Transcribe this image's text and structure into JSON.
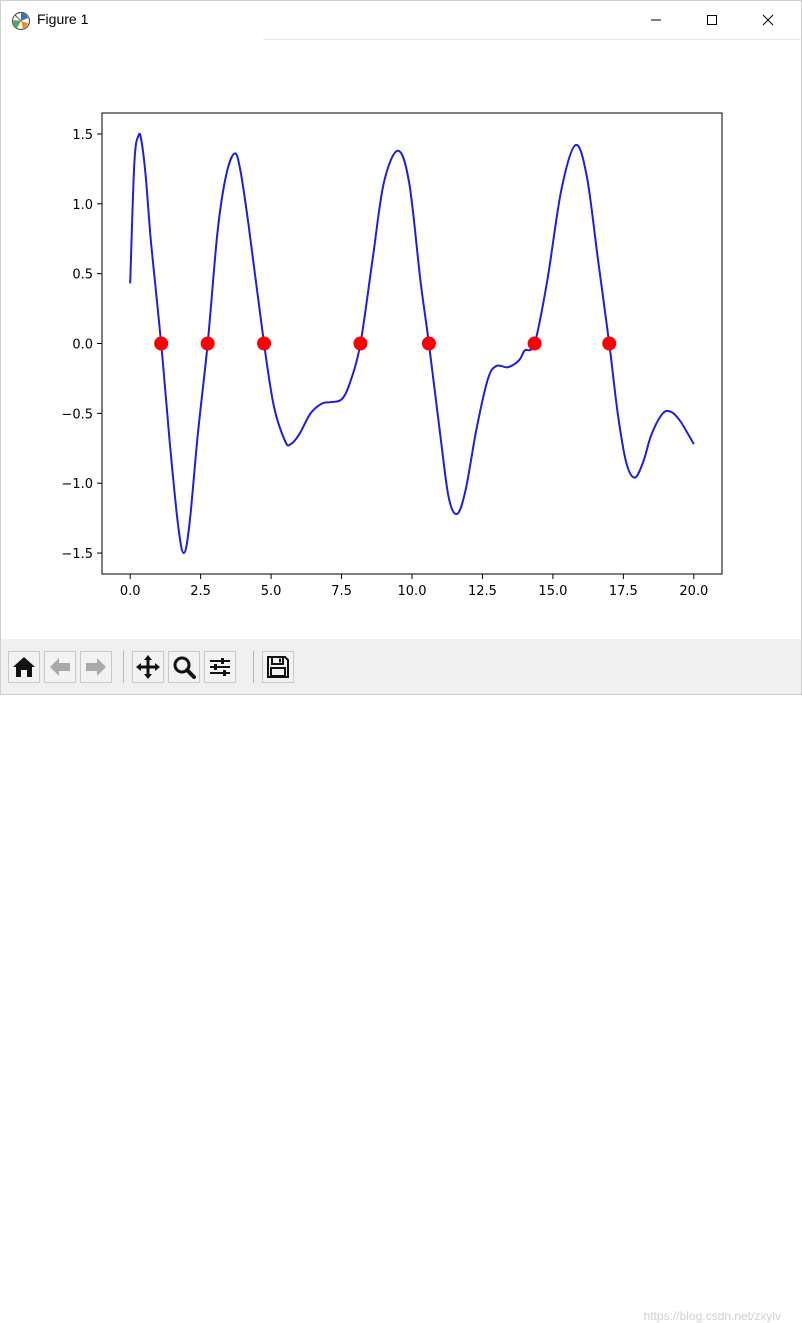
{
  "window": {
    "title": "Figure 1",
    "icon": "matplotlib-logo-icon",
    "controls": {
      "minimize": "minimize-icon",
      "maximize": "maximize-icon",
      "close": "close-icon"
    }
  },
  "toolbar": {
    "buttons": [
      {
        "name": "home",
        "icon": "home-icon"
      },
      {
        "name": "back",
        "icon": "arrow-left-icon"
      },
      {
        "name": "forward",
        "icon": "arrow-right-icon"
      },
      {
        "name": "pan",
        "icon": "move-icon"
      },
      {
        "name": "zoom",
        "icon": "magnifier-icon"
      },
      {
        "name": "configure-subplots",
        "icon": "sliders-icon"
      },
      {
        "name": "save",
        "icon": "floppy-disk-icon"
      }
    ]
  },
  "watermark": "https://blog.csdn.net/zxylv",
  "chart_data": {
    "type": "line",
    "title": "",
    "xlabel": "",
    "ylabel": "",
    "xlim": [
      -1,
      21
    ],
    "ylim": [
      -1.65,
      1.65
    ],
    "xticks": [
      0,
      2.5,
      5,
      7.5,
      10,
      12.5,
      15,
      17.5,
      20
    ],
    "xtick_labels": [
      "0.0",
      "2.5",
      "5.0",
      "7.5",
      "10.0",
      "12.5",
      "15.0",
      "17.5",
      "20.0"
    ],
    "yticks": [
      -1.5,
      -1,
      -0.5,
      0,
      0.5,
      1,
      1.5
    ],
    "ytick_labels": [
      "−1.5",
      "−1.0",
      "−0.5",
      "0.0",
      "0.5",
      "1.0",
      "1.5"
    ],
    "grid": false,
    "colors": {
      "curve": "#1f1fd8",
      "roots": "#ff0000"
    },
    "series": [
      {
        "x": [
          0,
          0.15,
          0.3,
          0.4,
          0.55,
          0.75,
          1.1,
          1.4,
          1.7,
          1.9,
          2.1,
          2.4,
          2.75,
          3.1,
          3.4,
          3.7,
          3.9,
          4.2,
          4.75,
          5.1,
          5.5,
          5.7,
          6.0,
          6.4,
          6.8,
          7.1,
          7.5,
          7.8,
          8.17,
          8.6,
          9.0,
          9.5,
          9.9,
          10.3,
          10.6,
          11.0,
          11.3,
          11.6,
          11.9,
          12.3,
          12.7,
          13.0,
          13.4,
          13.8,
          14.0,
          14.35,
          14.8,
          15.3,
          15.8,
          16.2,
          16.6,
          17.0,
          17.3,
          17.6,
          17.9,
          18.2,
          18.5,
          18.9,
          19.2,
          19.5,
          19.8,
          20.0
        ],
        "y": [
          0.43,
          1.3,
          1.49,
          1.45,
          1.2,
          0.7,
          0.0,
          -0.7,
          -1.3,
          -1.5,
          -1.3,
          -0.65,
          0.0,
          0.8,
          1.2,
          1.36,
          1.25,
          0.85,
          0.0,
          -0.45,
          -0.7,
          -0.72,
          -0.65,
          -0.5,
          -0.43,
          -0.42,
          -0.4,
          -0.28,
          0.0,
          0.6,
          1.15,
          1.38,
          1.15,
          0.45,
          0.0,
          -0.65,
          -1.1,
          -1.22,
          -1.05,
          -0.6,
          -0.25,
          -0.16,
          -0.17,
          -0.12,
          -0.05,
          0.0,
          0.45,
          1.1,
          1.42,
          1.2,
          0.6,
          0.0,
          -0.5,
          -0.85,
          -0.96,
          -0.85,
          -0.65,
          -0.5,
          -0.49,
          -0.55,
          -0.65,
          -0.72
        ]
      }
    ],
    "roots_x": [
      1.1,
      2.75,
      4.75,
      8.17,
      10.6,
      14.35,
      17.0
    ],
    "roots_y": [
      0,
      0,
      0,
      0,
      0,
      0,
      0
    ]
  }
}
